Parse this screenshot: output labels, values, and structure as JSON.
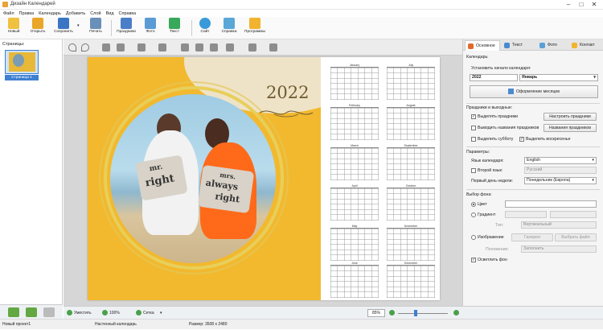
{
  "title": "Дизайн Календарей",
  "menu": [
    "Файл",
    "Правка",
    "Календарь",
    "Добавить",
    "Слой",
    "Вид",
    "Справка"
  ],
  "toolbar": {
    "new": "Новый",
    "open": "Открыть",
    "save": "Сохранить",
    "print": "Печать",
    "holidays": "Праздники",
    "photo": "Фото",
    "text": "Текст",
    "site": "Сайт",
    "help": "Справка",
    "programs": "Программы"
  },
  "left": {
    "header": "Страницы:",
    "page_label": "Страница 1"
  },
  "calendar": {
    "year": "2022",
    "months": [
      "January",
      "July",
      "February",
      "August",
      "March",
      "September",
      "April",
      "October",
      "May",
      "November",
      "June",
      "December"
    ]
  },
  "photo_text": {
    "pillow_left_1": "mr.",
    "pillow_left_2": "right",
    "pillow_right_1": "mrs.",
    "pillow_right_2": "always",
    "pillow_right_3": "right"
  },
  "right": {
    "tabs": [
      "Основное",
      "Текст",
      "Фото",
      "Контакт"
    ],
    "calendars_title": "Календарь:",
    "start_label": "Установить начало календаря:",
    "year_value": "2022",
    "month_value": "Январь",
    "design_button": "Оформление месяцев",
    "holidays_title": "Праздники и выходные:",
    "cb_holidays": "Выделять праздники",
    "btn_setup_holidays": "Настроить праздники",
    "cb_holiday_names": "Выводить названия праздников",
    "btn_holiday_names": "Названия праздников",
    "cb_saturday": "Выделить субботу",
    "cb_sunday": "Выделить воскресенье",
    "params_title": "Параметры:",
    "lang_label": "Язык календаря:",
    "lang_value": "English",
    "second_lang": "Второй язык:",
    "second_lang_value": "Русский",
    "first_day_label": "Первый день недели:",
    "first_day_value": "Понедельник (Европа)",
    "bg_title": "Выбор фона:",
    "rb_color": "Цвет",
    "rb_gradient": "Градиент",
    "type_label": "Тип:",
    "type_value": "Вертикальный",
    "rb_image": "Изображение",
    "btn_gallery": "Галерея",
    "btn_choose_file": "Выбрать файл",
    "position_label": "Положение:",
    "position_value": "Заполнить",
    "cb_darken": "Осветлить фон"
  },
  "status": {
    "fit": "Уместить",
    "zoom1": "100%",
    "grid": "Сетка",
    "zoom2": "85%",
    "project": "Новый проект1",
    "calendar_kind": "Настенный календарь",
    "size": "Размер: 3508 x 2480"
  },
  "colors": {
    "accent": "#3d7fd1",
    "yellow": "#f2b92e",
    "green": "#4aa14a"
  }
}
